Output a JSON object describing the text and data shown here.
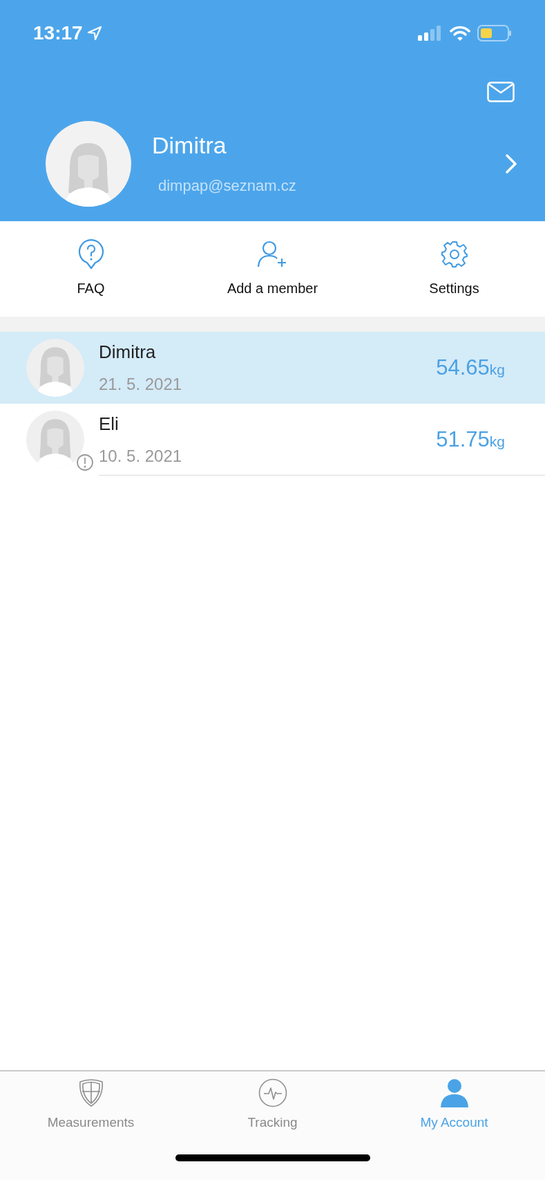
{
  "status_bar": {
    "time": "13:17"
  },
  "profile": {
    "name": "Dimitra",
    "email": "dimpap@seznam.cz"
  },
  "actions": [
    {
      "kind": "faq",
      "label": "FAQ"
    },
    {
      "kind": "add",
      "label": "Add a member"
    },
    {
      "kind": "settings",
      "label": "Settings"
    }
  ],
  "members": [
    {
      "name": "Dimitra",
      "date": "21. 5. 2021",
      "weight": "54.65",
      "unit": "kg",
      "selected": true,
      "warning": false
    },
    {
      "name": "Eli",
      "date": "10. 5. 2021",
      "weight": "51.75",
      "unit": "kg",
      "selected": false,
      "warning": true
    }
  ],
  "tabs": [
    {
      "kind": "measurements",
      "label": "Measurements",
      "selected": false
    },
    {
      "kind": "tracking",
      "label": "Tracking",
      "selected": false
    },
    {
      "kind": "account",
      "label": "My Account",
      "selected": true
    }
  ]
}
